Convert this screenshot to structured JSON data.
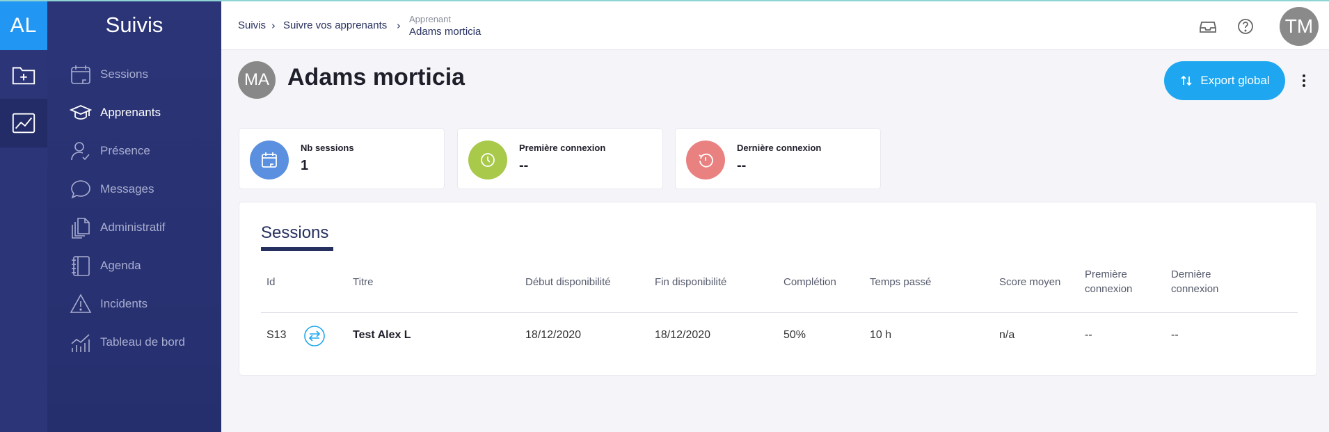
{
  "rail": {
    "logo": "AL"
  },
  "sidebar": {
    "title": "Suivis",
    "items": [
      {
        "label": "Sessions",
        "icon": "calendar-icon",
        "active": false
      },
      {
        "label": "Apprenants",
        "icon": "graduation-cap-icon",
        "active": true
      },
      {
        "label": "Présence",
        "icon": "user-check-icon",
        "active": false
      },
      {
        "label": "Messages",
        "icon": "chat-bubble-icon",
        "active": false
      },
      {
        "label": "Administratif",
        "icon": "documents-icon",
        "active": false
      },
      {
        "label": "Agenda",
        "icon": "notebook-icon",
        "active": false
      },
      {
        "label": "Incidents",
        "icon": "warning-icon",
        "active": false
      },
      {
        "label": "Tableau de bord",
        "icon": "chart-icon",
        "active": false
      }
    ]
  },
  "header": {
    "breadcrumb": [
      "Suivis",
      "Suivre vos apprenants"
    ],
    "current_label": "Apprenant",
    "current_value": "Adams morticia",
    "user_initials": "TM"
  },
  "page": {
    "avatar_initials": "MA",
    "title": "Adams morticia",
    "export_label": "Export global"
  },
  "stats": [
    {
      "label": "Nb sessions",
      "value": "1",
      "color": "#5b8fe0",
      "icon": "calendar-icon"
    },
    {
      "label": "Première connexion",
      "value": "--",
      "color": "#a8c94a",
      "icon": "clock-icon"
    },
    {
      "label": "Dernière connexion",
      "value": "--",
      "color": "#ea8181",
      "icon": "history-icon"
    }
  ],
  "sessions": {
    "title": "Sessions",
    "columns": {
      "id": "Id",
      "titre": "Titre",
      "debut": "Début disponibilité",
      "fin": "Fin disponibilité",
      "completion": "Complétion",
      "temps": "Temps passé",
      "score": "Score moyen",
      "premiere_a": "Première",
      "premiere_b": "connexion",
      "derniere_a": "Dernière",
      "derniere_b": "connexion"
    },
    "rows": [
      {
        "id": "S13",
        "titre": "Test Alex L",
        "debut": "18/12/2020",
        "fin": "18/12/2020",
        "completion": "50%",
        "temps": "10 h",
        "score": "n/a",
        "premiere": "--",
        "derniere": "--"
      }
    ]
  },
  "colors": {
    "accent": "#1ea7f0",
    "sidebar": "#2b3577",
    "logo": "#2196f3"
  }
}
